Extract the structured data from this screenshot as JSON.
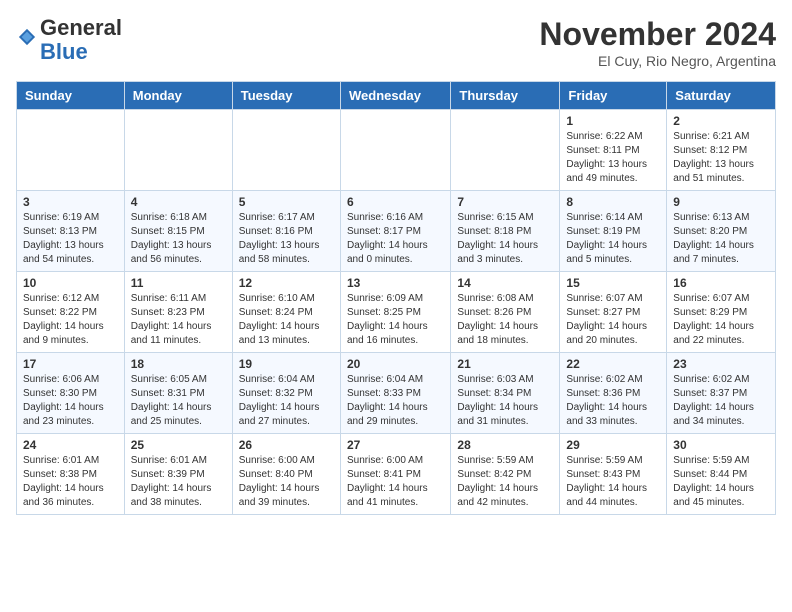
{
  "logo": {
    "general": "General",
    "blue": "Blue"
  },
  "header": {
    "month_year": "November 2024",
    "location": "El Cuy, Rio Negro, Argentina"
  },
  "weekdays": [
    "Sunday",
    "Monday",
    "Tuesday",
    "Wednesday",
    "Thursday",
    "Friday",
    "Saturday"
  ],
  "weeks": [
    [
      {
        "day": "",
        "info": ""
      },
      {
        "day": "",
        "info": ""
      },
      {
        "day": "",
        "info": ""
      },
      {
        "day": "",
        "info": ""
      },
      {
        "day": "",
        "info": ""
      },
      {
        "day": "1",
        "info": "Sunrise: 6:22 AM\nSunset: 8:11 PM\nDaylight: 13 hours\nand 49 minutes."
      },
      {
        "day": "2",
        "info": "Sunrise: 6:21 AM\nSunset: 8:12 PM\nDaylight: 13 hours\nand 51 minutes."
      }
    ],
    [
      {
        "day": "3",
        "info": "Sunrise: 6:19 AM\nSunset: 8:13 PM\nDaylight: 13 hours\nand 54 minutes."
      },
      {
        "day": "4",
        "info": "Sunrise: 6:18 AM\nSunset: 8:15 PM\nDaylight: 13 hours\nand 56 minutes."
      },
      {
        "day": "5",
        "info": "Sunrise: 6:17 AM\nSunset: 8:16 PM\nDaylight: 13 hours\nand 58 minutes."
      },
      {
        "day": "6",
        "info": "Sunrise: 6:16 AM\nSunset: 8:17 PM\nDaylight: 14 hours\nand 0 minutes."
      },
      {
        "day": "7",
        "info": "Sunrise: 6:15 AM\nSunset: 8:18 PM\nDaylight: 14 hours\nand 3 minutes."
      },
      {
        "day": "8",
        "info": "Sunrise: 6:14 AM\nSunset: 8:19 PM\nDaylight: 14 hours\nand 5 minutes."
      },
      {
        "day": "9",
        "info": "Sunrise: 6:13 AM\nSunset: 8:20 PM\nDaylight: 14 hours\nand 7 minutes."
      }
    ],
    [
      {
        "day": "10",
        "info": "Sunrise: 6:12 AM\nSunset: 8:22 PM\nDaylight: 14 hours\nand 9 minutes."
      },
      {
        "day": "11",
        "info": "Sunrise: 6:11 AM\nSunset: 8:23 PM\nDaylight: 14 hours\nand 11 minutes."
      },
      {
        "day": "12",
        "info": "Sunrise: 6:10 AM\nSunset: 8:24 PM\nDaylight: 14 hours\nand 13 minutes."
      },
      {
        "day": "13",
        "info": "Sunrise: 6:09 AM\nSunset: 8:25 PM\nDaylight: 14 hours\nand 16 minutes."
      },
      {
        "day": "14",
        "info": "Sunrise: 6:08 AM\nSunset: 8:26 PM\nDaylight: 14 hours\nand 18 minutes."
      },
      {
        "day": "15",
        "info": "Sunrise: 6:07 AM\nSunset: 8:27 PM\nDaylight: 14 hours\nand 20 minutes."
      },
      {
        "day": "16",
        "info": "Sunrise: 6:07 AM\nSunset: 8:29 PM\nDaylight: 14 hours\nand 22 minutes."
      }
    ],
    [
      {
        "day": "17",
        "info": "Sunrise: 6:06 AM\nSunset: 8:30 PM\nDaylight: 14 hours\nand 23 minutes."
      },
      {
        "day": "18",
        "info": "Sunrise: 6:05 AM\nSunset: 8:31 PM\nDaylight: 14 hours\nand 25 minutes."
      },
      {
        "day": "19",
        "info": "Sunrise: 6:04 AM\nSunset: 8:32 PM\nDaylight: 14 hours\nand 27 minutes."
      },
      {
        "day": "20",
        "info": "Sunrise: 6:04 AM\nSunset: 8:33 PM\nDaylight: 14 hours\nand 29 minutes."
      },
      {
        "day": "21",
        "info": "Sunrise: 6:03 AM\nSunset: 8:34 PM\nDaylight: 14 hours\nand 31 minutes."
      },
      {
        "day": "22",
        "info": "Sunrise: 6:02 AM\nSunset: 8:36 PM\nDaylight: 14 hours\nand 33 minutes."
      },
      {
        "day": "23",
        "info": "Sunrise: 6:02 AM\nSunset: 8:37 PM\nDaylight: 14 hours\nand 34 minutes."
      }
    ],
    [
      {
        "day": "24",
        "info": "Sunrise: 6:01 AM\nSunset: 8:38 PM\nDaylight: 14 hours\nand 36 minutes."
      },
      {
        "day": "25",
        "info": "Sunrise: 6:01 AM\nSunset: 8:39 PM\nDaylight: 14 hours\nand 38 minutes."
      },
      {
        "day": "26",
        "info": "Sunrise: 6:00 AM\nSunset: 8:40 PM\nDaylight: 14 hours\nand 39 minutes."
      },
      {
        "day": "27",
        "info": "Sunrise: 6:00 AM\nSunset: 8:41 PM\nDaylight: 14 hours\nand 41 minutes."
      },
      {
        "day": "28",
        "info": "Sunrise: 5:59 AM\nSunset: 8:42 PM\nDaylight: 14 hours\nand 42 minutes."
      },
      {
        "day": "29",
        "info": "Sunrise: 5:59 AM\nSunset: 8:43 PM\nDaylight: 14 hours\nand 44 minutes."
      },
      {
        "day": "30",
        "info": "Sunrise: 5:59 AM\nSunset: 8:44 PM\nDaylight: 14 hours\nand 45 minutes."
      }
    ]
  ]
}
